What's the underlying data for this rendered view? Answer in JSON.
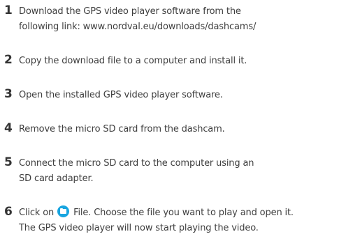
{
  "steps": [
    {
      "number": "1",
      "lines": [
        "Download the GPS video player software from the",
        "following link: www.nordval.eu/downloads/dashcams/"
      ]
    },
    {
      "number": "2",
      "lines": [
        "Copy the download file to a computer and install it."
      ]
    },
    {
      "number": "3",
      "lines": [
        "Open the installed GPS video player software."
      ]
    },
    {
      "number": "4",
      "lines": [
        "Remove the micro SD card from the dashcam."
      ]
    },
    {
      "number": "5",
      "lines": [
        "Connect the micro SD card to the computer using an",
        "SD card adapter."
      ]
    },
    {
      "number": "6",
      "line1_before_icon": "Click on",
      "icon": "folder-icon",
      "icon_color": "#18a5e0",
      "line1_after_icon": "File. Choose the file you want to play and open it.",
      "line2": "The GPS video player will now start playing the video."
    }
  ]
}
